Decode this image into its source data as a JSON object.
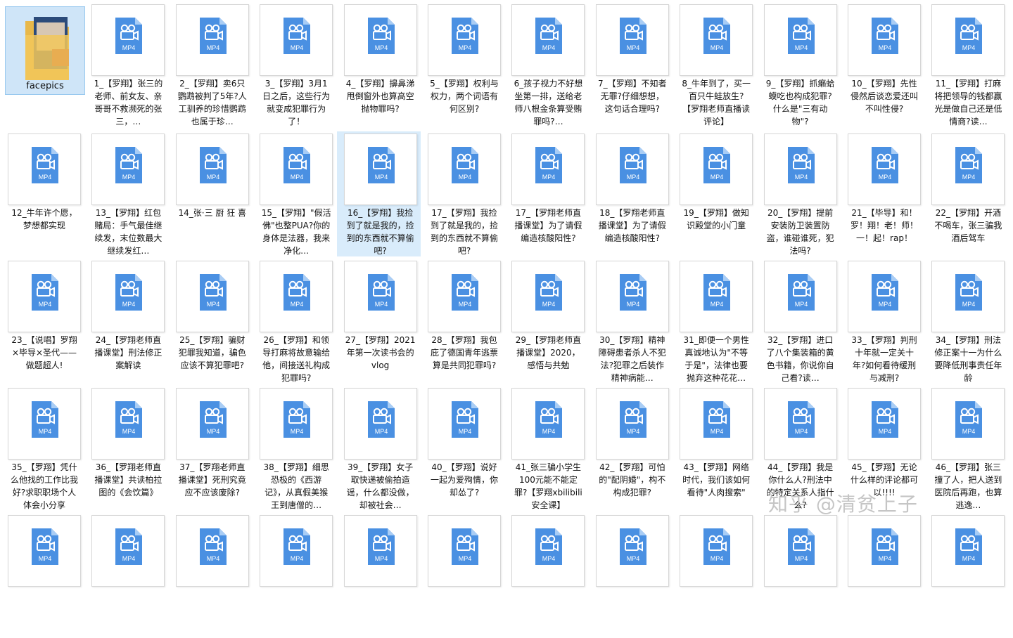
{
  "watermark": "知乎 @清贫上子",
  "items": [
    {
      "name": "facepics",
      "type": "folder"
    },
    {
      "name": "1_【罗翔】张三的老师、前女友、亲哥哥不救濒死的张三，…",
      "type": "MP4"
    },
    {
      "name": "2_【罗翔】卖6只鹦鹉被判了5年?人工驯养的珍惜鹦鹉也属于珍…",
      "type": "MP4"
    },
    {
      "name": "3_【罗翔】3月1日之后，这些行为就变成犯罪行为了！",
      "type": "MP4"
    },
    {
      "name": "4_【罗翔】擤鼻涕甩倒窗外也算高空抛物罪吗?",
      "type": "MP4"
    },
    {
      "name": "5_【罗翔】权利与权力，两个词语有何区别?",
      "type": "MP4"
    },
    {
      "name": "6_孩子视力不好想坐第一排，送给老师八根金条算受贿罪吗?…",
      "type": "MP4"
    },
    {
      "name": "7_【罗翔】不知者无罪?仔细想想，这句话合理吗?",
      "type": "MP4"
    },
    {
      "name": "8_牛年到了，买一百只牛蛙放生?【罗翔老师直播读评论】",
      "type": "MP4"
    },
    {
      "name": "9_【罗翔】抓癞蛤蟆吃也构成犯罪?什么是\"三有动物\"?",
      "type": "MP4"
    },
    {
      "name": "10_【罗翔】先性侵然后谈恋爱还叫不叫性侵?",
      "type": "MP4"
    },
    {
      "name": "11_【罗翔】打麻将把领导的钱都赢光是做自己还是低情商?读…",
      "type": "MP4"
    },
    {
      "name": "12_牛年许个愿，梦想都实现",
      "type": "MP4"
    },
    {
      "name": "13_【罗翔】红包赌局：手气最佳继续发，末位数最大继续发红…",
      "type": "MP4"
    },
    {
      "name": "14_张·三 厨 狂 喜",
      "type": "MP4"
    },
    {
      "name": "15_【罗翔】\"假活佛\"也整PUA?你的身体是法器，我来净化…",
      "type": "MP4"
    },
    {
      "name": "16_【罗翔】我捡到了就是我的，捡到的东西就不算偷吧?",
      "type": "MP4",
      "selected": true
    },
    {
      "name": "17_【罗翔】我捡到了就是我的，捡到的东西就不算偷吧?",
      "type": "MP4"
    },
    {
      "name": "17_【罗翔老师直播课堂】为了请假编造核酸阳性?",
      "type": "MP4"
    },
    {
      "name": "18_【罗翔老师直播课堂】为了请假编造核酸阳性?",
      "type": "MP4"
    },
    {
      "name": "19_【罗翔】做知识殿堂的小门童",
      "type": "MP4"
    },
    {
      "name": "20_【罗翔】提前安装防卫装置防盗，谁碰谁死，犯法吗?",
      "type": "MP4"
    },
    {
      "name": "21_【毕导】和！罗！翔！老！师！一！起！rap！",
      "type": "MP4"
    },
    {
      "name": "22_【罗翔】开酒不喝车，张三骗我酒后驾车",
      "type": "MP4"
    },
    {
      "name": "23_【说唱】罗翔×毕导×圣代——做题超人!",
      "type": "MP4"
    },
    {
      "name": "24_【罗翔老师直播课堂】刑法修正案解读",
      "type": "MP4"
    },
    {
      "name": "25_【罗翔】骗财犯罪我知道，骗色应该不算犯罪吧?",
      "type": "MP4"
    },
    {
      "name": "26_【罗翔】和领导打麻将故意输给他，间接送礼构成犯罪吗?",
      "type": "MP4"
    },
    {
      "name": "27_【罗翔】2021年第一次读书会的vlog",
      "type": "MP4"
    },
    {
      "name": "28_【罗翔】我包庇了德国青年逃票算是共同犯罪吗?",
      "type": "MP4"
    },
    {
      "name": "29_【罗翔老师直播课堂】2020，感悟与共勉",
      "type": "MP4"
    },
    {
      "name": "30_【罗翔】精神障碍患者杀人不犯法?犯罪之后装作精神病能…",
      "type": "MP4"
    },
    {
      "name": "31_即便一个男性真诚地认为\"不等于是\"，法律也要抛弃这种花花…",
      "type": "MP4"
    },
    {
      "name": "32_【罗翔】进口了八个集装箱的黄色书籍，你说你自己看?读…",
      "type": "MP4"
    },
    {
      "name": "33_【罗翔】判刑十年就一定关十年?如何看待缓刑与减刑?",
      "type": "MP4"
    },
    {
      "name": "34_【罗翔】刑法修正案十一为什么要降低刑事责任年龄",
      "type": "MP4"
    },
    {
      "name": "35_【罗翔】凭什么他找的工作比我好?求职职场个人体会小分享",
      "type": "MP4"
    },
    {
      "name": "36_【罗翔老师直播课堂】共读柏拉图的《会饮篇》",
      "type": "MP4"
    },
    {
      "name": "37_【罗翔老师直播课堂】死刑究竟应不应该废除?",
      "type": "MP4"
    },
    {
      "name": "38_【罗翔】细思恐极的《西游记》，从真假美猴王到唐僧的…",
      "type": "MP4"
    },
    {
      "name": "39_【罗翔】女子取快递被偷拍造谣，什么都没做，却被社会…",
      "type": "MP4"
    },
    {
      "name": "40_【罗翔】说好一起为爱殉情，你却怂了?",
      "type": "MP4"
    },
    {
      "name": "41_张三骗小学生100元能不能定罪?【罗翔xbilibili安全课】",
      "type": "MP4"
    },
    {
      "name": "42_【罗翔】可怕的\"配阴婚\"，构不构成犯罪?",
      "type": "MP4"
    },
    {
      "name": "43_【罗翔】网络时代，我们该如何看待\"人肉搜索\"",
      "type": "MP4"
    },
    {
      "name": "44_【罗翔】我是你什么人?刑法中的特定关系人指什么?",
      "type": "MP4"
    },
    {
      "name": "45_【罗翔】无论什么样的评论都可以!!!!",
      "type": "MP4"
    },
    {
      "name": "46_【罗翔】张三撞了人，把人送到医院后再跑，也算逃逸…",
      "type": "MP4"
    },
    {
      "name": "",
      "type": "MP4"
    },
    {
      "name": "",
      "type": "MP4"
    },
    {
      "name": "",
      "type": "MP4"
    },
    {
      "name": "",
      "type": "MP4"
    },
    {
      "name": "",
      "type": "MP4"
    },
    {
      "name": "",
      "type": "MP4"
    },
    {
      "name": "",
      "type": "MP4"
    },
    {
      "name": "",
      "type": "MP4"
    },
    {
      "name": "",
      "type": "MP4"
    },
    {
      "name": "",
      "type": "MP4"
    },
    {
      "name": "",
      "type": "MP4"
    },
    {
      "name": "",
      "type": "MP4"
    }
  ]
}
